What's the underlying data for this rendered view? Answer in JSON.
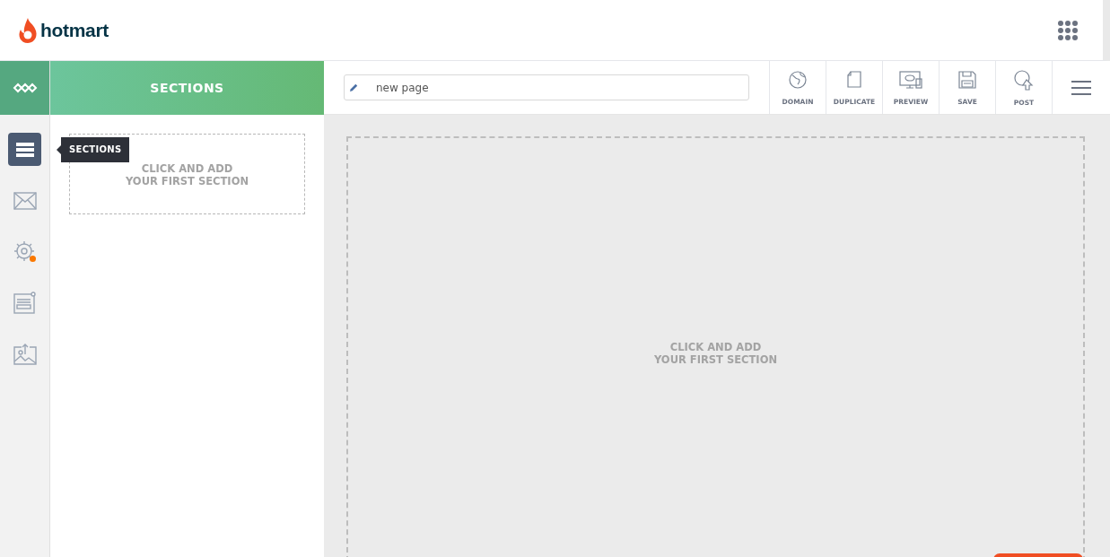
{
  "header": {
    "logo_text": "hotmart"
  },
  "panel": {
    "title": "SECTIONS",
    "empty_prompt": [
      "CLICK AND ADD",
      "YOUR FIRST SECTION"
    ]
  },
  "sidebar": {
    "items": [
      {
        "kind": "sections",
        "selected": true,
        "alert": false
      },
      {
        "kind": "mail",
        "selected": false,
        "alert": false
      },
      {
        "kind": "settings",
        "selected": false,
        "alert": true
      },
      {
        "kind": "form",
        "selected": false,
        "alert": false
      },
      {
        "kind": "image",
        "selected": false,
        "alert": false
      }
    ],
    "tooltip": "SECTIONS"
  },
  "toolbar": {
    "page_name": "new page",
    "actions": [
      {
        "kind": "domain",
        "label": "DOMAIN"
      },
      {
        "kind": "duplicate",
        "label": "DUPLICATE"
      },
      {
        "kind": "preview",
        "label": "PREVIEW"
      },
      {
        "kind": "save",
        "label": "SAVE"
      },
      {
        "kind": "post",
        "label": "POST"
      }
    ]
  },
  "canvas": {
    "empty_prompt": [
      "CLICK AND ADD",
      "YOUR FIRST SECTION"
    ]
  }
}
